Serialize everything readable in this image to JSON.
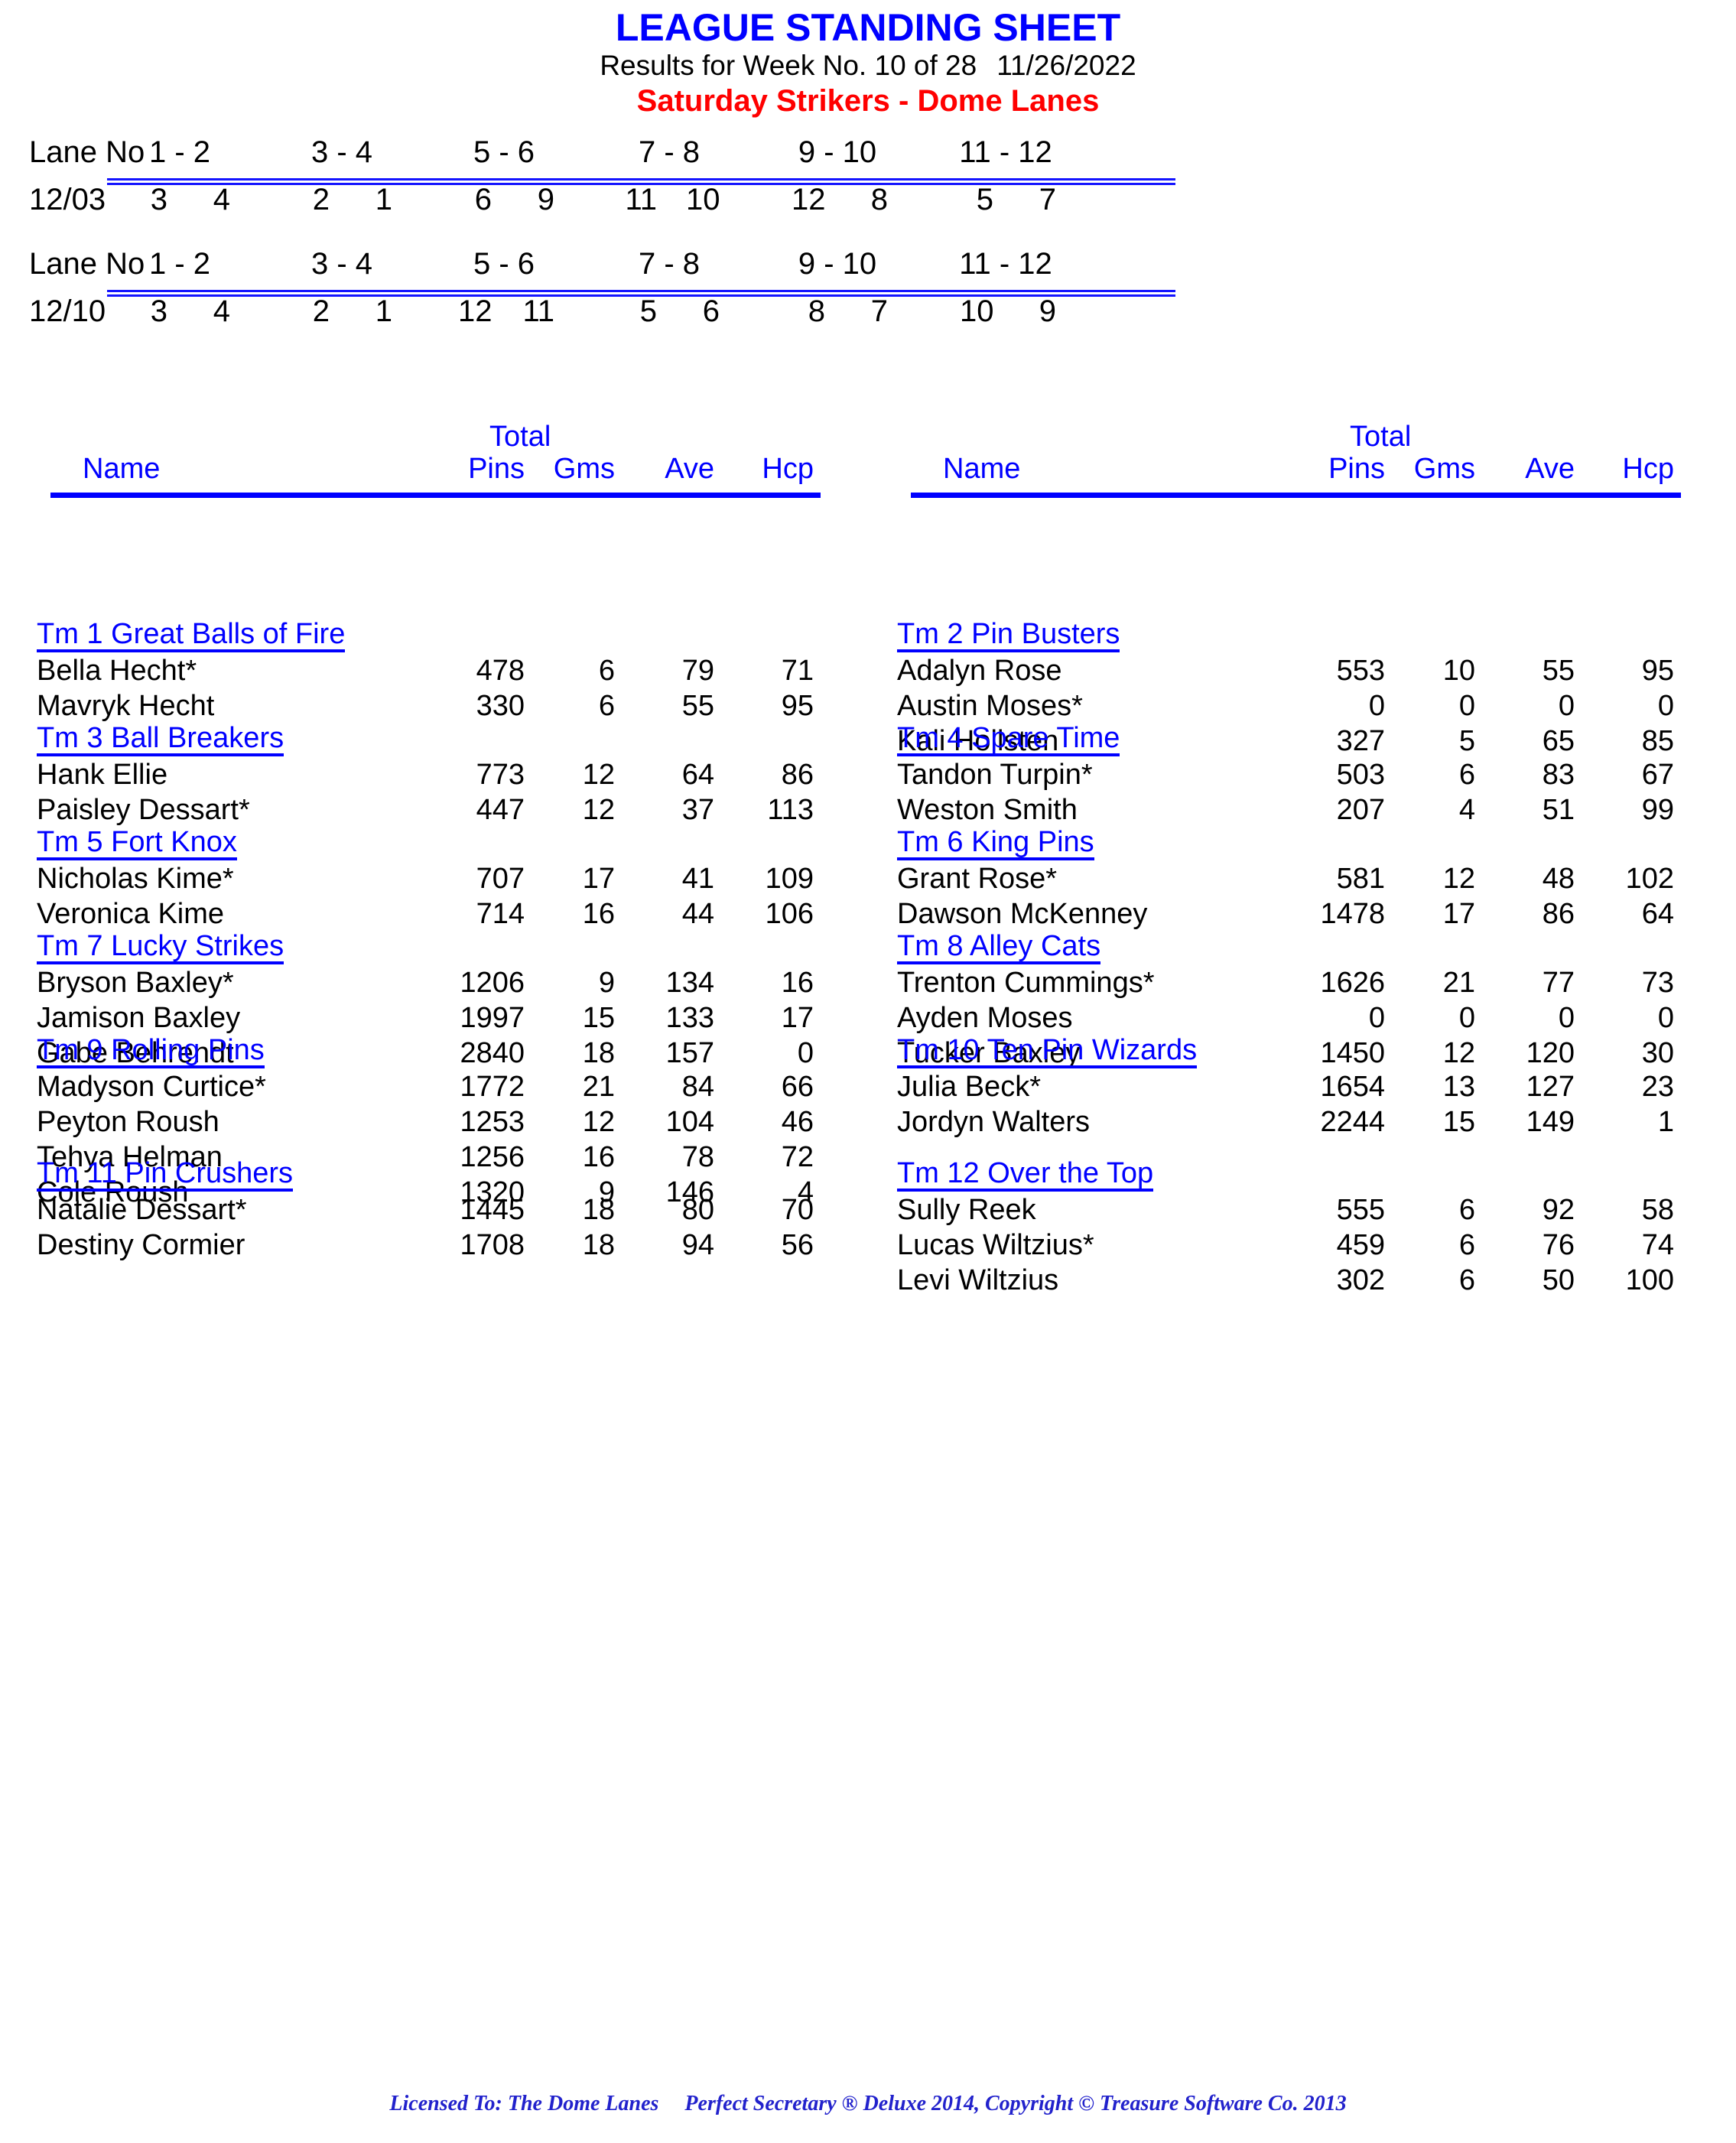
{
  "header": {
    "title": "LEAGUE STANDING SHEET",
    "results_prefix": "Results for Week No. 10 of 28",
    "date": "11/26/2022",
    "league": "Saturday Strikers - Dome Lanes",
    "title_color": "#0000FF",
    "league_color": "#FF0000"
  },
  "lane_blocks": [
    {
      "label": "Lane No",
      "date": "12/03",
      "pairs": [
        "1 - 2",
        "3 - 4",
        "5 - 6",
        "7 - 8",
        "9 - 10",
        "11 - 12"
      ],
      "assignments": [
        [
          "3",
          "4"
        ],
        [
          "2",
          "1"
        ],
        [
          "6",
          "9"
        ],
        [
          "11",
          "10"
        ],
        [
          "12",
          "8"
        ],
        [
          "5",
          "7"
        ]
      ]
    },
    {
      "label": "Lane No",
      "date": "12/10",
      "pairs": [
        "1 - 2",
        "3 - 4",
        "5 - 6",
        "7 - 8",
        "9 - 10",
        "11 - 12"
      ],
      "assignments": [
        [
          "3",
          "4"
        ],
        [
          "2",
          "1"
        ],
        [
          "12",
          "11"
        ],
        [
          "5",
          "6"
        ],
        [
          "8",
          "7"
        ],
        [
          "10",
          "9"
        ]
      ]
    }
  ],
  "table_header": {
    "total": "Total",
    "name": "Name",
    "columns": [
      "Pins",
      "Gms",
      "Ave",
      "Hcp"
    ]
  },
  "left_column": [
    {
      "team": "Tm 1 Great Balls of Fire",
      "players": [
        {
          "name": "Bella Hecht*",
          "pins": "478",
          "gms": "6",
          "ave": "79",
          "hcp": "71"
        },
        {
          "name": "Mavryk Hecht",
          "pins": "330",
          "gms": "6",
          "ave": "55",
          "hcp": "95"
        }
      ]
    },
    {
      "team": "Tm 3 Ball Breakers",
      "players": [
        {
          "name": "Hank Ellie",
          "pins": "773",
          "gms": "12",
          "ave": "64",
          "hcp": "86"
        },
        {
          "name": "Paisley Dessart*",
          "pins": "447",
          "gms": "12",
          "ave": "37",
          "hcp": "113"
        }
      ]
    },
    {
      "team": "Tm 5 Fort Knox",
      "players": [
        {
          "name": "Nicholas Kime*",
          "pins": "707",
          "gms": "17",
          "ave": "41",
          "hcp": "109"
        },
        {
          "name": "Veronica Kime",
          "pins": "714",
          "gms": "16",
          "ave": "44",
          "hcp": "106"
        }
      ]
    },
    {
      "team": "Tm 7 Lucky Strikes",
      "players": [
        {
          "name": "Bryson Baxley*",
          "pins": "1206",
          "gms": "9",
          "ave": "134",
          "hcp": "16"
        },
        {
          "name": "Jamison Baxley",
          "pins": "1997",
          "gms": "15",
          "ave": "133",
          "hcp": "17"
        },
        {
          "name": "Gabe Behrendt",
          "pins": "2840",
          "gms": "18",
          "ave": "157",
          "hcp": "0"
        }
      ]
    },
    {
      "team": "Tm 9 Rolling Pins",
      "players": [
        {
          "name": "Madyson Curtice*",
          "pins": "1772",
          "gms": "21",
          "ave": "84",
          "hcp": "66"
        },
        {
          "name": "Peyton Roush",
          "pins": "1253",
          "gms": "12",
          "ave": "104",
          "hcp": "46"
        },
        {
          "name": "Tehya Helman",
          "pins": "1256",
          "gms": "16",
          "ave": "78",
          "hcp": "72"
        },
        {
          "name": "Cole Roush",
          "pins": "1320",
          "gms": "9",
          "ave": "146",
          "hcp": "4"
        }
      ]
    },
    {
      "team": "Tm 11 Pin Crushers",
      "players": [
        {
          "name": "Natalie Dessart*",
          "pins": "1445",
          "gms": "18",
          "ave": "80",
          "hcp": "70"
        },
        {
          "name": "Destiny Cormier",
          "pins": "1708",
          "gms": "18",
          "ave": "94",
          "hcp": "56"
        }
      ]
    }
  ],
  "right_column": [
    {
      "team": "Tm 2 Pin Busters",
      "players": [
        {
          "name": "Adalyn Rose",
          "pins": "553",
          "gms": "10",
          "ave": "55",
          "hcp": "95"
        },
        {
          "name": "Austin Moses*",
          "pins": "0",
          "gms": "0",
          "ave": "0",
          "hcp": "0"
        },
        {
          "name": "Kali Hollsten",
          "pins": "327",
          "gms": "5",
          "ave": "65",
          "hcp": "85"
        }
      ]
    },
    {
      "team": "Tm 4 Spare Time",
      "players": [
        {
          "name": "Tandon Turpin*",
          "pins": "503",
          "gms": "6",
          "ave": "83",
          "hcp": "67"
        },
        {
          "name": "Weston Smith",
          "pins": "207",
          "gms": "4",
          "ave": "51",
          "hcp": "99"
        }
      ]
    },
    {
      "team": "Tm 6 King Pins",
      "players": [
        {
          "name": "Grant Rose*",
          "pins": "581",
          "gms": "12",
          "ave": "48",
          "hcp": "102"
        },
        {
          "name": "Dawson McKenney",
          "pins": "1478",
          "gms": "17",
          "ave": "86",
          "hcp": "64"
        }
      ]
    },
    {
      "team": "Tm 8 Alley Cats",
      "players": [
        {
          "name": "Trenton Cummings*",
          "pins": "1626",
          "gms": "21",
          "ave": "77",
          "hcp": "73"
        },
        {
          "name": "Ayden Moses",
          "pins": "0",
          "gms": "0",
          "ave": "0",
          "hcp": "0"
        },
        {
          "name": "Tucker Baxley",
          "pins": "1450",
          "gms": "12",
          "ave": "120",
          "hcp": "30"
        }
      ]
    },
    {
      "team": "Tm 10 Ten Pin Wizards",
      "players": [
        {
          "name": "Julia Beck*",
          "pins": "1654",
          "gms": "13",
          "ave": "127",
          "hcp": "23"
        },
        {
          "name": "Jordyn Walters",
          "pins": "2244",
          "gms": "15",
          "ave": "149",
          "hcp": "1"
        }
      ]
    },
    {
      "team": "Tm 12 Over the Top",
      "players": [
        {
          "name": "Sully Reek",
          "pins": "555",
          "gms": "6",
          "ave": "92",
          "hcp": "58"
        },
        {
          "name": "Lucas Wiltzius*",
          "pins": "459",
          "gms": "6",
          "ave": "76",
          "hcp": "74"
        },
        {
          "name": "Levi Wiltzius",
          "pins": "302",
          "gms": "6",
          "ave": "50",
          "hcp": "100"
        }
      ]
    }
  ],
  "footer": {
    "licensed_to": "Licensed To: The Dome Lanes",
    "software": "Perfect Secretary ® Deluxe  2014, Copyright © Treasure Software Co. 2013"
  }
}
